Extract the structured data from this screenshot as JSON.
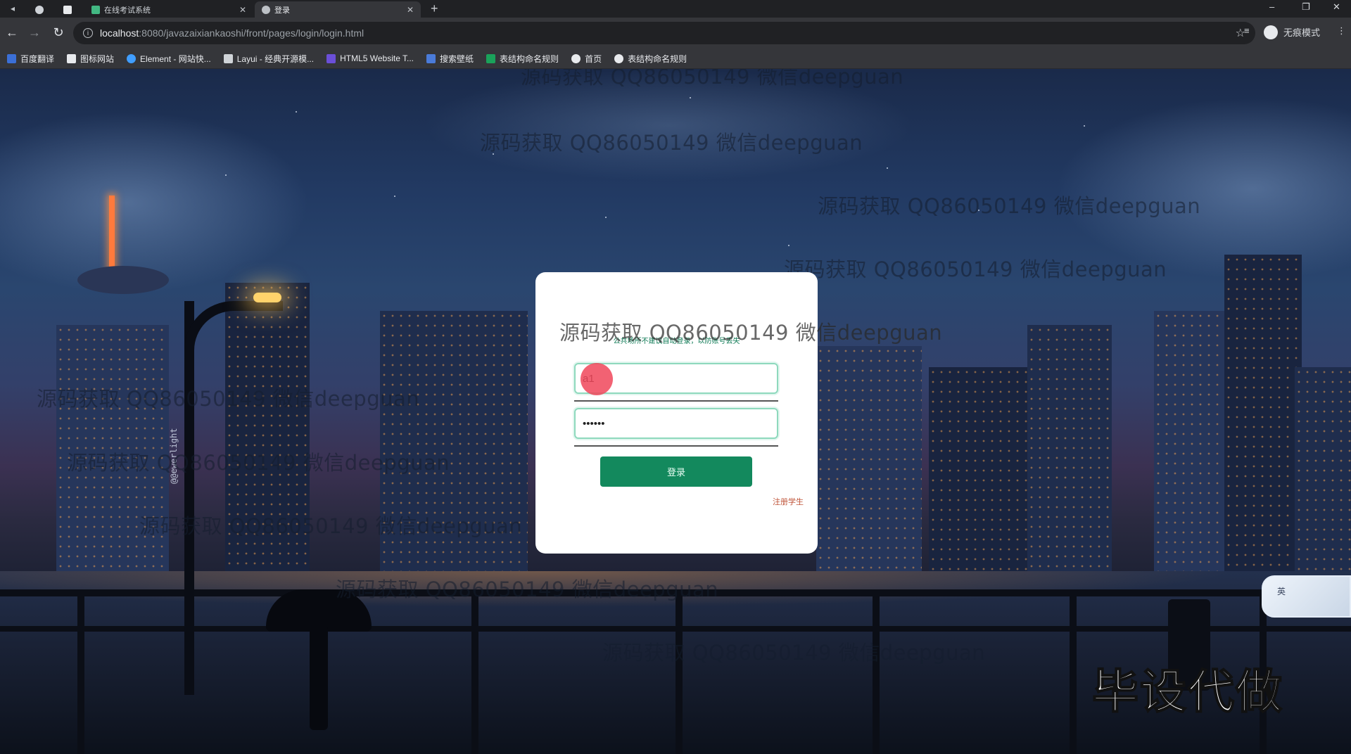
{
  "browser": {
    "tabs": [
      {
        "title": "",
        "active": false
      },
      {
        "title": "",
        "active": false
      },
      {
        "title": "在线考试系统",
        "active": false
      },
      {
        "title": "登录",
        "active": true
      }
    ],
    "new_tab_symbol": "+",
    "window_controls": {
      "minimize": "–",
      "restore": "❐",
      "close": "✕"
    },
    "nav": {
      "back": "←",
      "forward": "→",
      "reload": "↻"
    },
    "url": {
      "host": "localhost",
      "rest": ":8080/javazaixiankaoshi/front/pages/login/login.html"
    },
    "profile_label": "无痕模式",
    "bookmarks": [
      {
        "label": "百度翻译",
        "icon_color": "#3b6fd6"
      },
      {
        "label": "图标网站",
        "icon_color": "#e8eaed"
      },
      {
        "label": "Element - 网站快...",
        "icon_color": "#409eff"
      },
      {
        "label": "Layui - 经典开源模...",
        "icon_color": "#d0d4d8"
      },
      {
        "label": "HTML5 Website T...",
        "icon_color": "#6b4fd8"
      },
      {
        "label": "搜索壁纸",
        "icon_color": "#4a7bd9"
      },
      {
        "label": "表结构命名规则",
        "icon_color": "#1aa25a"
      },
      {
        "label": "首页",
        "icon_color": "#e8eaed"
      },
      {
        "label": "表结构命名规则",
        "icon_color": "#e8eaed"
      }
    ]
  },
  "watermark_text": "源码获取 QQ86050149 微信deepguan",
  "login": {
    "hint": "公共场所不建议自动登录，以防账号丢失",
    "username_value": "a1",
    "password_value": "••••••",
    "login_button": "登录",
    "register_link": "注册学生"
  },
  "overlays": {
    "ime_label": "英",
    "promo_text": "毕设代做",
    "vertical_credit": "@@ewerlight"
  },
  "colors": {
    "accent": "#13895d",
    "input_border": "#8ed9bd",
    "register": "#c0553a"
  }
}
